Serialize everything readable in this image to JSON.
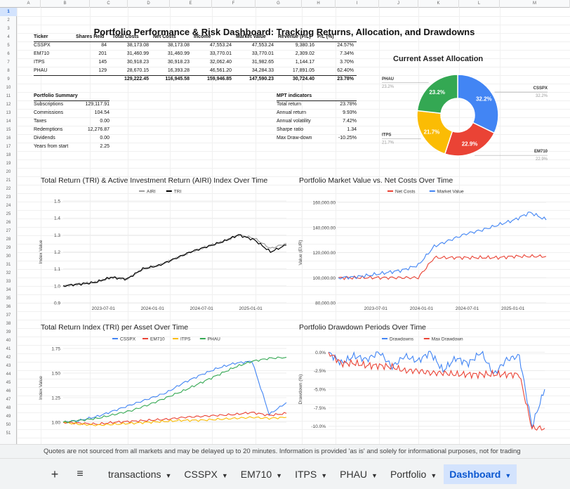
{
  "columns": [
    "A",
    "B",
    "C",
    "D",
    "E",
    "F",
    "G",
    "H",
    "I",
    "J",
    "K",
    "L",
    "M"
  ],
  "title": "Portfolio Performance & Risk Dashboard: Tracking Returns, Allocation, and Drawdowns",
  "holdings": {
    "headers": [
      "Ticker",
      "Shares Held",
      "Total Costs",
      "Net Costs",
      "Income",
      "Market Value",
      "Revenue (P/L)",
      "P/L (%)"
    ],
    "rows": [
      [
        "CSSPX",
        "84",
        "38,173.08",
        "38,173.08",
        "47,553.24",
        "47,553.24",
        "9,380.16",
        "24.57%"
      ],
      [
        "EM710",
        "201",
        "31,460.99",
        "31,460.99",
        "33,770.01",
        "33,770.01",
        "2,309.02",
        "7.34%"
      ],
      [
        "ITPS",
        "145",
        "30,918.23",
        "30,918.23",
        "32,062.40",
        "31,982.65",
        "1,144.17",
        "3.70%"
      ],
      [
        "PHAU",
        "129",
        "28,670.15",
        "16,393.28",
        "46,561.20",
        "34,284.33",
        "17,891.05",
        "62.40%"
      ]
    ],
    "totals": [
      "",
      "",
      "129,222.45",
      "116,945.58",
      "159,946.85",
      "147,590.23",
      "30,724.40",
      "23.78%"
    ]
  },
  "summary": {
    "title": "Portfolio Summary",
    "rows": [
      [
        "Subscriptions",
        "129,117.91"
      ],
      [
        "Commissions",
        "104.54"
      ],
      [
        "Taxes",
        "0.00"
      ],
      [
        "Redemptions",
        "12,276.87"
      ],
      [
        "Dividends",
        "0.00"
      ],
      [
        "Years from start",
        "2.25"
      ]
    ]
  },
  "mpt": {
    "title": "MPT indicators",
    "rows": [
      [
        "Total return",
        "23.78%"
      ],
      [
        "Annual return",
        "9.93%"
      ],
      [
        "Annual volatility",
        "7.42%"
      ],
      [
        "Sharpe ratio",
        "1.34"
      ],
      [
        "Max Draw-down",
        "-10.25%"
      ]
    ]
  },
  "allocation": {
    "title": "Current Asset Allocation",
    "slices": [
      {
        "name": "CSSPX",
        "value": 32.2,
        "label": "32.2%",
        "color": "#4285f4"
      },
      {
        "name": "EM710",
        "value": 22.9,
        "label": "22.9%",
        "color": "#ea4335"
      },
      {
        "name": "ITPS",
        "value": 21.7,
        "label": "21.7%",
        "color": "#fbbc04"
      },
      {
        "name": "PHAU",
        "value": 23.2,
        "label": "23.2%",
        "color": "#34a853"
      }
    ]
  },
  "chart_data": [
    {
      "type": "line",
      "title": "Total Return (TRI) & Active Investment Return (AIRI) Index Over Time",
      "ylabel": "Index Value",
      "ylim": [
        0.9,
        1.5
      ],
      "yticks": [
        "1.5",
        "1.4",
        "1.3",
        "1.2",
        "1.1",
        "1.0",
        "0.9"
      ],
      "xticks": [
        "2023-07-01",
        "2024-01-01",
        "2024-07-01",
        "2025-01-01"
      ],
      "series": [
        {
          "name": "AIRI",
          "color": "#9e9e9e",
          "values": [
            1.0,
            1.01,
            1.02,
            1.05,
            1.04,
            1.1,
            1.12,
            1.16,
            1.2,
            1.23,
            1.26,
            1.3,
            1.28,
            1.22,
            1.25
          ]
        },
        {
          "name": "TRI",
          "color": "#000000",
          "values": [
            1.0,
            1.01,
            1.02,
            1.05,
            1.04,
            1.1,
            1.12,
            1.16,
            1.2,
            1.23,
            1.26,
            1.3,
            1.27,
            1.2,
            1.24
          ]
        }
      ]
    },
    {
      "type": "line",
      "title": "Portfolio Market Value vs. Net Costs Over Time",
      "ylabel": "Value (EUR)",
      "ylim": [
        80000,
        160000
      ],
      "yticks": [
        "160,000.00",
        "140,000.00",
        "120,000.00",
        "100,000.00",
        "80,000.00"
      ],
      "xticks": [
        "2023-07-01",
        "2024-01-01",
        "2024-07-01",
        "2025-01-01"
      ],
      "series": [
        {
          "name": "Net Costs",
          "color": "#ea4335",
          "values": [
            100000,
            100000,
            100000,
            100000,
            100000,
            100000,
            116000,
            116000,
            116000,
            116000,
            116000,
            117000,
            117000,
            117000
          ]
        },
        {
          "name": "Market Value",
          "color": "#4285f4",
          "values": [
            100000,
            100500,
            102000,
            104000,
            106000,
            110000,
            125000,
            130000,
            135000,
            138000,
            142000,
            146000,
            152000,
            146000
          ]
        }
      ]
    },
    {
      "type": "line",
      "title": "Total Return Index (TRI) per Asset Over Time",
      "ylabel": "Index Value",
      "ylim": [
        0.95,
        1.75
      ],
      "yticks": [
        "1.75",
        "1.50",
        "1.25",
        "1.00"
      ],
      "xticks": [],
      "series": [
        {
          "name": "CSSPX",
          "color": "#4285f4",
          "values": [
            1.0,
            1.02,
            1.06,
            1.12,
            1.18,
            1.24,
            1.3,
            1.4,
            1.48,
            1.55,
            1.6,
            1.62,
            1.08,
            1.2
          ]
        },
        {
          "name": "EM710",
          "color": "#ea4335",
          "values": [
            1.0,
            0.99,
            0.98,
            1.0,
            1.01,
            1.02,
            1.03,
            1.05,
            1.06,
            1.07,
            1.08,
            1.1,
            1.07,
            1.09
          ]
        },
        {
          "name": "ITPS",
          "color": "#fbbc04",
          "values": [
            1.0,
            0.98,
            0.97,
            0.98,
            0.99,
            1.0,
            1.01,
            1.02,
            1.02,
            1.03,
            1.04,
            1.05,
            1.04,
            1.05
          ]
        },
        {
          "name": "PHAU",
          "color": "#34a853",
          "values": [
            1.0,
            1.02,
            1.04,
            1.08,
            1.12,
            1.18,
            1.25,
            1.32,
            1.4,
            1.48,
            1.56,
            1.62,
            1.65,
            1.66
          ]
        }
      ]
    },
    {
      "type": "line",
      "title": "Portfolio Drawdown Periods Over Time",
      "ylabel": "Drawdown (%)",
      "ylim": [
        -10.5,
        0.5
      ],
      "yticks": [
        "0.0%",
        "-2.5%",
        "-5.0%",
        "-7.5%",
        "-10.0%"
      ],
      "xticks": [],
      "series": [
        {
          "name": "Drawdowns",
          "color": "#4285f4",
          "values": [
            0,
            -1.5,
            -0.5,
            -1,
            0,
            -2,
            -0.5,
            -1.2,
            0,
            -2.5,
            -0.8,
            -1.5,
            0,
            -3,
            -1,
            -0.5,
            -10,
            -5
          ]
        },
        {
          "name": "Max Drawdown",
          "color": "#ea4335",
          "values": [
            0,
            -1.5,
            -1.5,
            -1.8,
            -1.8,
            -2,
            -2.5,
            -2.5,
            -2.8,
            -2.8,
            -3,
            -3,
            -3,
            -3,
            -3,
            -3,
            -10.25,
            -10.25
          ]
        }
      ]
    }
  ],
  "status_text": "Quotes are not sourced from all markets and may be delayed up to 20 minutes. Information is provided 'as is' and solely for informational purposes, not for trading",
  "tabs": [
    "transactions",
    "CSSPX",
    "EM710",
    "ITPS",
    "PHAU",
    "Portfolio",
    "Dashboard"
  ],
  "active_tab": "Dashboard"
}
